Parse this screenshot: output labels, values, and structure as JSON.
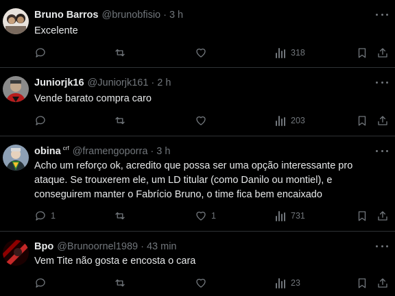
{
  "tweets": [
    {
      "name": "Bruno Barros",
      "badge": "",
      "handle": "@brunobfisio",
      "time": "3 h",
      "text": "Excelente",
      "replies": "",
      "reposts": "",
      "likes": "",
      "views": "318",
      "avatar_colors": [
        "#3b2f2a",
        "#c9a27e",
        "#e8e2dc"
      ]
    },
    {
      "name": "Juniorjk16",
      "badge": "",
      "handle": "@Juniorjk161",
      "time": "2 h",
      "text": "Vende barato compra caro",
      "replies": "",
      "reposts": "",
      "likes": "",
      "views": "203",
      "avatar_colors": [
        "#6f6f6f",
        "#b5b5b5",
        "#b71c1c"
      ]
    },
    {
      "name": "obina",
      "badge": "crf",
      "handle": "@framengoporra",
      "time": "3 h",
      "text": "Acho um reforço ok, acredito que possa ser uma opção interessante pro ataque. Se trouxerem ele, um LD titular (como Danilo ou montiel), e conseguirem manter o Fabrício Bruno, o time fica bem encaixado",
      "replies": "1",
      "reposts": "",
      "likes": "1",
      "views": "731",
      "avatar_colors": [
        "#8da0b5",
        "#e6d2bd",
        "#2e7d32"
      ]
    },
    {
      "name": "Bpo",
      "badge": "",
      "handle": "@Brunoornel1989",
      "time": "43 min",
      "text": "Vem Tite não gosta e encosta o cara",
      "replies": "",
      "reposts": "",
      "likes": "",
      "views": "23",
      "avatar_colors": [
        "#1a0000",
        "#c62828",
        "#000000"
      ]
    }
  ],
  "icons": {
    "reply": "speech-bubble-icon",
    "repost": "repost-arrows-icon",
    "like": "heart-icon",
    "views": "bar-chart-icon",
    "bookmark": "bookmark-icon",
    "share": "upload-share-icon",
    "more": "more-dots-icon"
  }
}
